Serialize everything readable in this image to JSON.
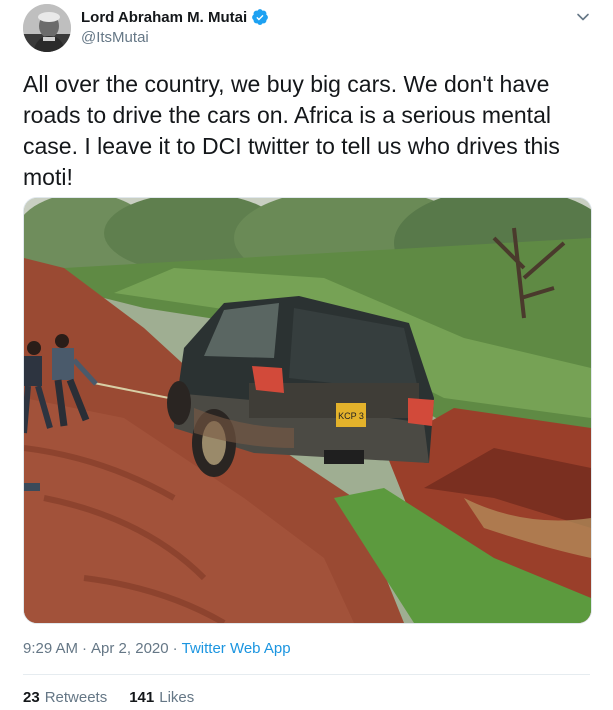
{
  "author": {
    "display_name": "Lord Abraham M. Mutai",
    "handle": "@ItsMutai",
    "verified": true,
    "avatar_icon": "profile-photo"
  },
  "tweet": {
    "text": "All over the country, we buy big cars. We don't have roads to drive the cars on. Africa is a serious mental case. I leave it to DCI twitter to tell us who drives this moti!",
    "media": {
      "plate_text": "KCP 3"
    }
  },
  "meta": {
    "time": "9:29 AM",
    "separator": "·",
    "date": "Apr 2, 2020",
    "source": "Twitter Web App"
  },
  "stats": {
    "retweets_count": "23",
    "retweets_label": "Retweets",
    "likes_count": "141",
    "likes_label": "Likes"
  },
  "colors": {
    "link": "#1b95e0",
    "secondary_text": "#657786",
    "primary_text": "#14171a",
    "verified": "#1da1f2"
  }
}
